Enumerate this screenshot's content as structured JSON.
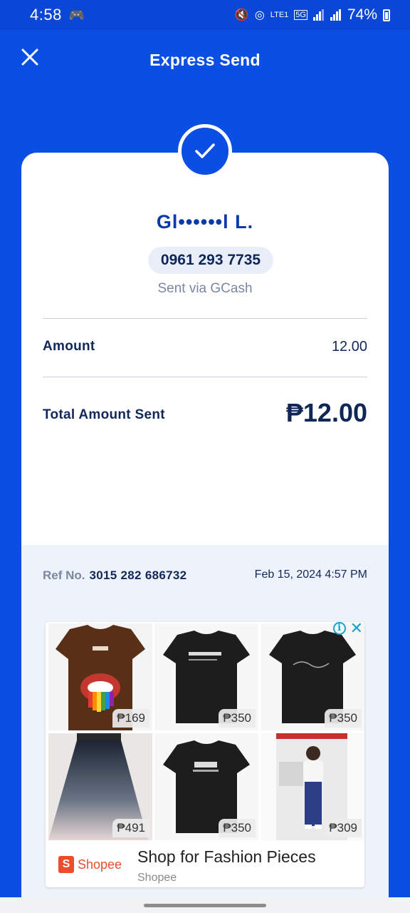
{
  "status_bar": {
    "time": "4:58",
    "network": "5G",
    "carrier": "LTE1",
    "battery": "74%"
  },
  "header": {
    "title": "Express Send"
  },
  "receipt": {
    "recipient_name": "Gl••••••l L.",
    "phone": "0961 293 7735",
    "sent_via": "Sent via GCash",
    "amount_label": "Amount",
    "amount_value": "12.00",
    "total_label": "Total Amount Sent",
    "total_value": "₱12.00",
    "ref_label": "Ref No.",
    "ref_no": "3015 282 686732",
    "date": "Feb 15, 2024 4:57 PM"
  },
  "ad": {
    "products": [
      {
        "price": "₱169"
      },
      {
        "price": "₱350"
      },
      {
        "price": "₱350"
      },
      {
        "price": "₱491"
      },
      {
        "price": "₱350"
      },
      {
        "price": "₱309"
      }
    ],
    "brand": "Shopee",
    "headline": "Shop for Fashion Pieces",
    "advertiser": "Shopee"
  },
  "colors": {
    "primary": "#0b4ee3",
    "shopee": "#ee4d2d"
  }
}
